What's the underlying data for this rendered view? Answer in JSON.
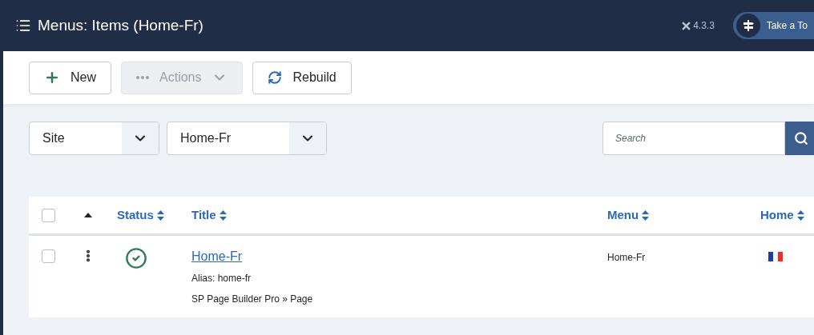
{
  "header": {
    "title": "Menus: Items (Home-Fr)",
    "version": "4.3.3",
    "tour_button": "Take a To"
  },
  "toolbar": [
    {
      "kind": "new",
      "label": "New",
      "disabled": false
    },
    {
      "kind": "actions",
      "label": "Actions",
      "disabled": true
    },
    {
      "kind": "rebuild",
      "label": "Rebuild",
      "disabled": false
    }
  ],
  "filters": [
    {
      "value": "Site"
    },
    {
      "value": "Home-Fr"
    }
  ],
  "search": {
    "placeholder": "Search"
  },
  "table": {
    "select_all_checked": false,
    "columns": [
      "Status",
      "Title",
      "Menu",
      "Home"
    ],
    "rows": [
      {
        "checked": false,
        "published": true,
        "title": "Home-Fr",
        "alias": "Alias: home-fr",
        "type": "SP Page Builder Pro » Page",
        "menu": "Home-Fr"
      }
    ]
  }
}
